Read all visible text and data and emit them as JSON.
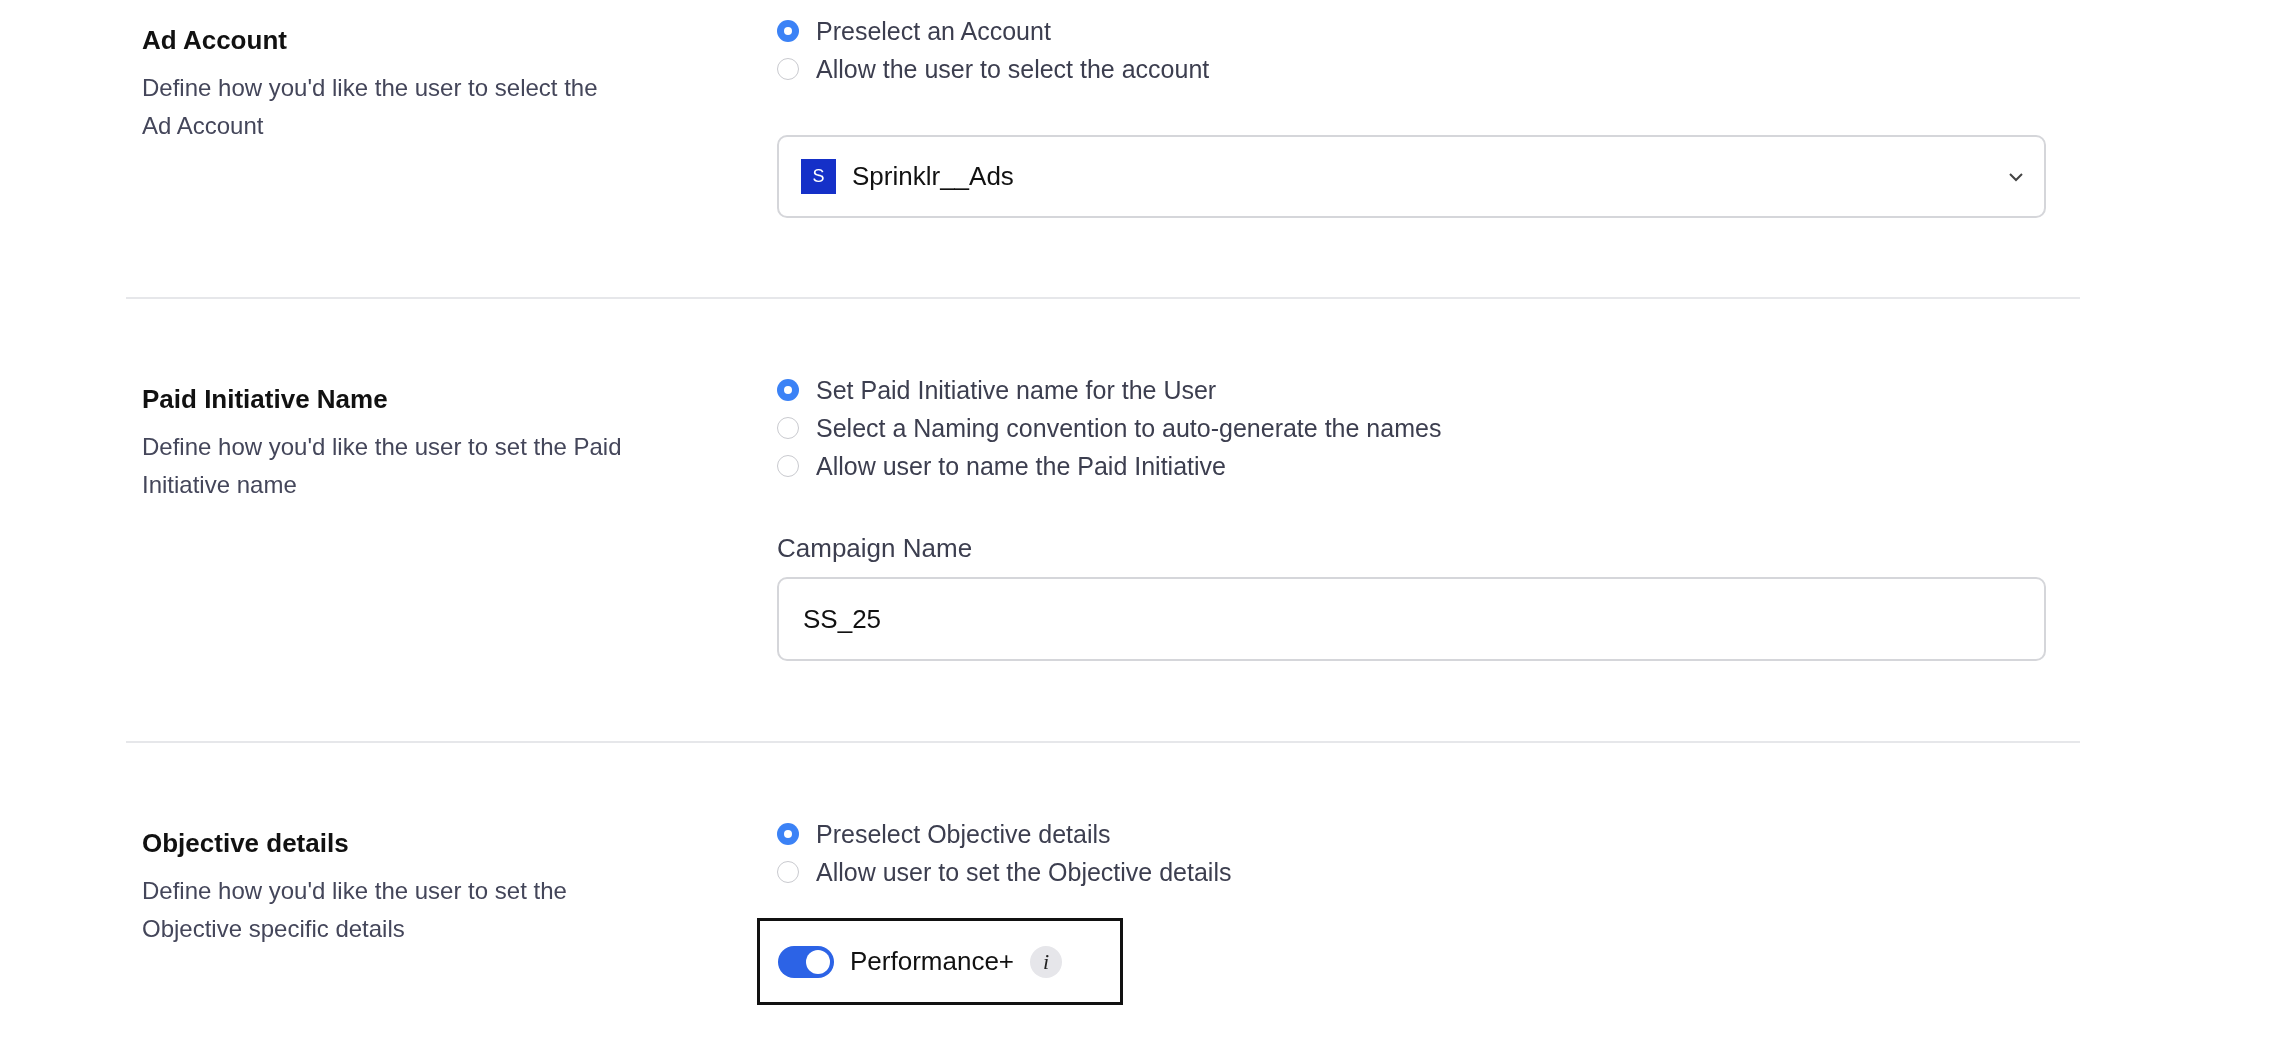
{
  "sections": [
    {
      "kind": "select",
      "title": "Ad Account",
      "description": "Define how you'd like the user to select the Ad Account",
      "options": [
        {
          "label": "Preselect an Account",
          "selected": true
        },
        {
          "label": "Allow the user to select the account",
          "selected": false
        }
      ],
      "dropdown": {
        "badge": "S",
        "value": "Sprinklr__Ads"
      }
    },
    {
      "kind": "text_input",
      "title": "Paid Initiative Name",
      "description": "Define how you'd like the user to set the Paid Initiative name",
      "options": [
        {
          "label": "Set Paid Initiative name for the User",
          "selected": true
        },
        {
          "label": "Select a Naming convention to auto-generate the names",
          "selected": false
        },
        {
          "label": "Allow user to name the Paid Initiative",
          "selected": false
        }
      ],
      "field": {
        "label": "Campaign Name",
        "value": "SS_25"
      }
    },
    {
      "kind": "toggle",
      "title": "Objective details",
      "description": "Define how you'd like the user to set the Objective specific details",
      "options": [
        {
          "label": "Preselect Objective details",
          "selected": true
        },
        {
          "label": "Allow user to set the Objective details",
          "selected": false
        }
      ],
      "toggle": {
        "label": "Performance+",
        "on": true,
        "info": "i"
      }
    }
  ]
}
